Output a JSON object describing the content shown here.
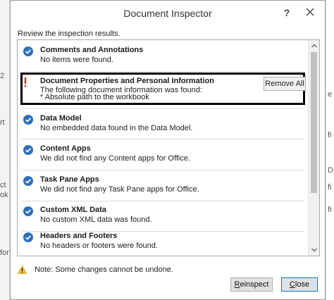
{
  "dialog": {
    "title": "Document Inspector",
    "help_glyph": "?",
    "instructions": "Review the inspection results.",
    "note": "Note: Some changes cannot be undone."
  },
  "items": [
    {
      "status": "ok",
      "title": "Comments and Annotations",
      "detail": "No items were found."
    },
    {
      "status": "warning",
      "title": "Document Properties and Personal Information",
      "detail": "The following document information was found:",
      "detail2": "* Absolute path to the workbook",
      "action_label": "Remove All"
    },
    {
      "status": "ok",
      "title": "Data Model",
      "detail": "No embedded data found in the Data Model."
    },
    {
      "status": "ok",
      "title": "Content Apps",
      "detail": "We did not find any Content apps for Office."
    },
    {
      "status": "ok",
      "title": "Task Pane Apps",
      "detail": "We did not find any Task Pane apps for Office."
    },
    {
      "status": "ok",
      "title": "Custom XML Data",
      "detail": "No custom XML data was found."
    },
    {
      "status": "ok",
      "title": "Headers and Footers",
      "detail": "No headers or footers were found."
    }
  ],
  "buttons": {
    "reinspect_first": "R",
    "reinspect_rest": "einspect",
    "close_first": "C",
    "close_rest": "lose"
  },
  "background_fragments": {
    "left": [
      "2",
      "rt",
      "ct",
      "ok",
      "for"
    ],
    "right": [
      "e",
      "fi",
      "D",
      "fi",
      "fi"
    ]
  },
  "colors": {
    "ok_icon": "#2e6fb7",
    "warning_icon": "#c0392b",
    "accent_border": "#0078d7"
  }
}
